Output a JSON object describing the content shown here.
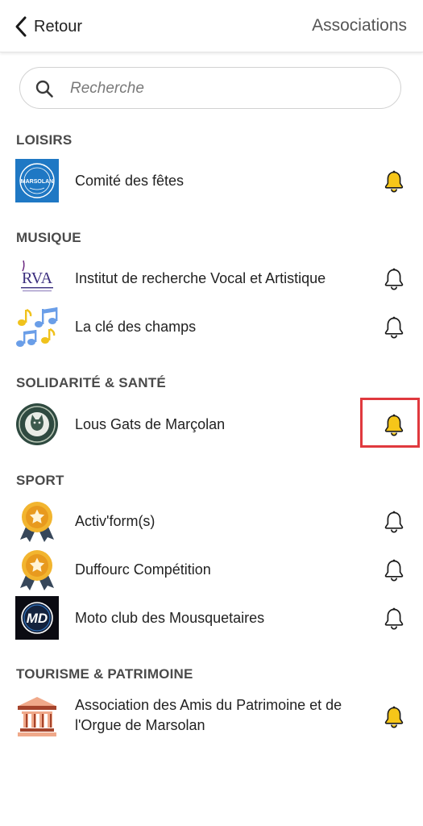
{
  "header": {
    "back_label": "Retour",
    "title": "Associations"
  },
  "search": {
    "placeholder": "Recherche",
    "value": ""
  },
  "sections": [
    {
      "title": "LOISIRS",
      "items": [
        {
          "name": "Comité des fêtes",
          "logo": "marsolan-seal",
          "notifications": "on"
        }
      ]
    },
    {
      "title": "MUSIQUE",
      "items": [
        {
          "name": "Institut de recherche Vocal  et Artistique",
          "logo": "rva-logo",
          "notifications": "off"
        },
        {
          "name": "La clé des champs",
          "logo": "music-notes",
          "notifications": "off"
        }
      ]
    },
    {
      "title": "SOLIDARITÉ & SANTÉ",
      "items": [
        {
          "name": "Lous Gats de Marçolan",
          "logo": "cat-seal",
          "notifications": "on",
          "highlighted": true
        }
      ]
    },
    {
      "title": "SPORT",
      "items": [
        {
          "name": "Activ'form(s)",
          "logo": "medal",
          "notifications": "off"
        },
        {
          "name": "Duffourc Compétition",
          "logo": "medal",
          "notifications": "off"
        },
        {
          "name": "Moto club des Mousquetaires",
          "logo": "md-logo",
          "notifications": "off"
        }
      ]
    },
    {
      "title": "TOURISME & PATRIMOINE",
      "items": [
        {
          "name": "Association des Amis du Patrimoine et de l'Orgue de Marsolan",
          "logo": "monument",
          "notifications": "on"
        }
      ]
    }
  ],
  "logo_texts": {
    "rva": "RVA",
    "md": "MD",
    "marsolan": "MARSOLAN"
  },
  "colors": {
    "bell_active": "#f6c619",
    "highlight": "#e0393e",
    "marsolan_blue": "#1f78c4"
  }
}
